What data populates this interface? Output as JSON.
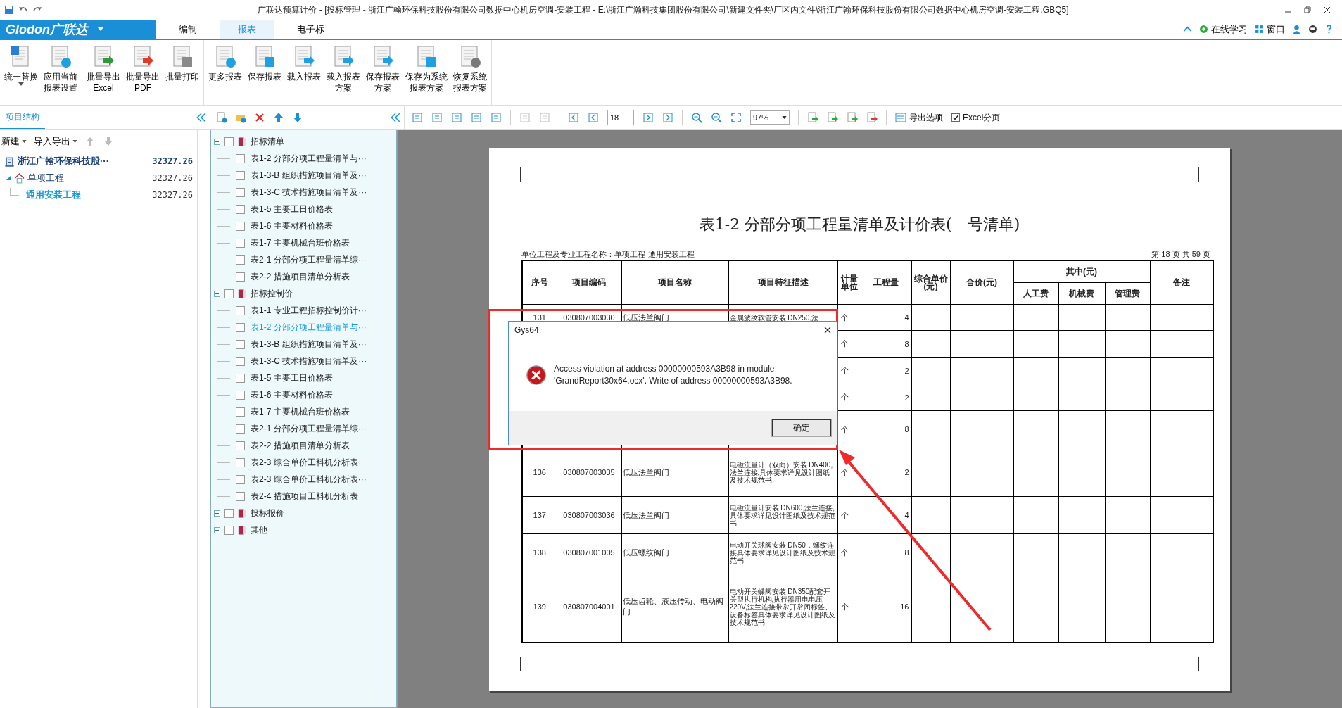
{
  "window": {
    "title": "广联达预算计价 - [投标管理 - 浙江广翰环保科技股份有限公司数据中心机房空调-安装工程 - E:\\浙江广瀚科技集团股份有限公司\\新建文件夹\\厂区内文件\\浙江广翰环保科技股份有限公司数据中心机房空调-安装工程.GBQ5]"
  },
  "menu": {
    "logo": "Glodon广联达",
    "tabs": [
      {
        "label": "编制",
        "selected": false
      },
      {
        "label": "报表",
        "selected": true
      },
      {
        "label": "电子标",
        "selected": false
      }
    ],
    "online_learning": "在线学习",
    "window_menu": "窗口"
  },
  "ribbon": {
    "groups": [
      [
        {
          "lines": [
            "统一替换"
          ],
          "dropdown": true
        },
        {
          "lines": [
            "应用当前",
            "报表设置"
          ],
          "dropdown": false
        }
      ],
      [
        {
          "lines": [
            "批量导出",
            "Excel"
          ],
          "dropdown": false
        },
        {
          "lines": [
            "批量导出",
            "PDF"
          ],
          "dropdown": false
        },
        {
          "lines": [
            "批量打印"
          ],
          "dropdown": false
        }
      ],
      [
        {
          "lines": [
            "更多报表"
          ],
          "dropdown": false
        },
        {
          "lines": [
            "保存报表"
          ],
          "dropdown": false
        },
        {
          "lines": [
            "载入报表"
          ],
          "dropdown": false
        },
        {
          "lines": [
            "载入报表",
            "方案"
          ],
          "dropdown": false
        },
        {
          "lines": [
            "保存报表",
            "方案"
          ],
          "dropdown": false
        },
        {
          "lines": [
            "保存为系统",
            "报表方案"
          ],
          "dropdown": false
        },
        {
          "lines": [
            "恢复系统",
            "报表方案"
          ],
          "dropdown": false
        }
      ]
    ]
  },
  "project_panel": {
    "tab": "项目结构",
    "new": "新建",
    "import_export": "导入导出",
    "tree": [
      {
        "label": "浙江广翰环保科技股···",
        "amount": "32327.26",
        "selected": false,
        "children": [
          {
            "label": "单项工程",
            "amount": "32327.26",
            "selected": false,
            "expanded": true,
            "children": [
              {
                "label": "通用安装工程",
                "amount": "32327.26",
                "selected": true
              }
            ]
          }
        ]
      }
    ]
  },
  "report_tree": [
    {
      "label": "招标清单",
      "checked": false,
      "expanded": true,
      "children": [
        {
          "label": "表1-2 分部分项工程量清单与···",
          "checked": false,
          "selected": false
        },
        {
          "label": "表1-3-B 组织措施项目清单及···",
          "checked": false,
          "selected": false
        },
        {
          "label": "表1-3-C 技术措施项目清单及···",
          "checked": false,
          "selected": false
        },
        {
          "label": "表1-5 主要工日价格表",
          "checked": false,
          "selected": false
        },
        {
          "label": "表1-6 主要材料价格表",
          "checked": false,
          "selected": false
        },
        {
          "label": "表1-7 主要机械台班价格表",
          "checked": false,
          "selected": false
        },
        {
          "label": "表2-1 分部分项工程量清单综···",
          "checked": false,
          "selected": false
        },
        {
          "label": "表2-2 措施项目清单分析表",
          "checked": false,
          "selected": false
        }
      ]
    },
    {
      "label": "招标控制价",
      "checked": false,
      "expanded": true,
      "children": [
        {
          "label": "表1-1 专业工程招标控制价计···",
          "checked": false,
          "selected": false
        },
        {
          "label": "表1-2 分部分项工程量清单与···",
          "checked": false,
          "selected": true
        },
        {
          "label": "表1-3-B 组织措施项目清单及···",
          "checked": false,
          "selected": false
        },
        {
          "label": "表1-3-C 技术措施项目清单及···",
          "checked": false,
          "selected": false
        },
        {
          "label": "表1-5 主要工日价格表",
          "checked": false,
          "selected": false
        },
        {
          "label": "表1-6 主要材料价格表",
          "checked": false,
          "selected": false
        },
        {
          "label": "表1-7 主要机械台班价格表",
          "checked": false,
          "selected": false
        },
        {
          "label": "表2-1 分部分项工程量清单综···",
          "checked": false,
          "selected": false
        },
        {
          "label": "表2-2 措施项目清单分析表",
          "checked": false,
          "selected": false
        },
        {
          "label": "表2-3 综合单价工料机分析表",
          "checked": false,
          "selected": false
        },
        {
          "label": "表2-3 综合单价工料机分析表···",
          "checked": false,
          "selected": false
        },
        {
          "label": "表2-4 措施项目工料机分析表",
          "checked": false,
          "selected": false
        }
      ]
    },
    {
      "label": "投标报价",
      "checked": false,
      "expanded": false
    },
    {
      "label": "其他",
      "checked": false,
      "expanded": false
    }
  ],
  "preview_toolbar": {
    "page": "18",
    "zoom": "97%",
    "export_options": "导出选项",
    "excel_pages": {
      "label": "Excel分页",
      "checked": true
    }
  },
  "report": {
    "title": "表1-2 分部分项工程量清单及计价表(　号清单)",
    "project_name": "单位工程及专业工程名称：单项工程-通用安装工程",
    "page_info": "第 18 页  共 59 页",
    "columns": [
      "序号",
      "项目编码",
      "项目名称",
      "项目特征描述",
      "计量单位",
      "工程量",
      "综合单价(元)",
      "合价(元)"
    ],
    "group_header": "其中(元)",
    "sub_columns": [
      "人工费",
      "机械费",
      "管理费"
    ],
    "last_column": "备注",
    "rows": [
      {
        "seq": "131",
        "code": "030807003030",
        "name": "低压法兰阀门",
        "description": "金属波纹软管安装 DN250,法",
        "unit": "个",
        "quantity": "4"
      },
      {
        "unit": "个",
        "quantity": "8"
      },
      {
        "unit": "个",
        "quantity": "2"
      },
      {
        "unit": "个",
        "quantity": "2"
      },
      {
        "unit": "个",
        "quantity": "8"
      },
      {
        "seq": "136",
        "code": "030807003035",
        "name": "低压法兰阀门",
        "description": "电磁流量计（双向）安装 DN400,法兰连接,具体要求详见设计图纸及技术规范书",
        "unit": "个",
        "quantity": "2"
      },
      {
        "seq": "137",
        "code": "030807003036",
        "name": "低压法兰阀门",
        "description": "电磁流量计安装 DN600,法兰连接,具体要求详见设计图纸及技术规范书",
        "unit": "个",
        "quantity": "4"
      },
      {
        "seq": "138",
        "code": "030807001005",
        "name": "低压螺纹阀门",
        "description": "电动开关球阀安装 DN50，螺纹连接具体要求详见设计图纸及技术规范书",
        "unit": "个",
        "quantity": "8"
      },
      {
        "seq": "139",
        "code": "030807004001",
        "name": "低压齿轮、液压传动、电动阀门",
        "description": "电动开关蝶阀安装 DN350配套开关型执行机构,执行器用电电压220V,法兰连接带常开常闭标签、设备标签具体要求详见设计图纸及技术规范书",
        "unit": "个",
        "quantity": "16"
      }
    ]
  },
  "dialog": {
    "title": "Gys64",
    "message": "Access violation at address 00000000593A3B98 in module 'GrandReport30x64.ocx'. Write of address 00000000593A3B98.",
    "button": "确定"
  }
}
